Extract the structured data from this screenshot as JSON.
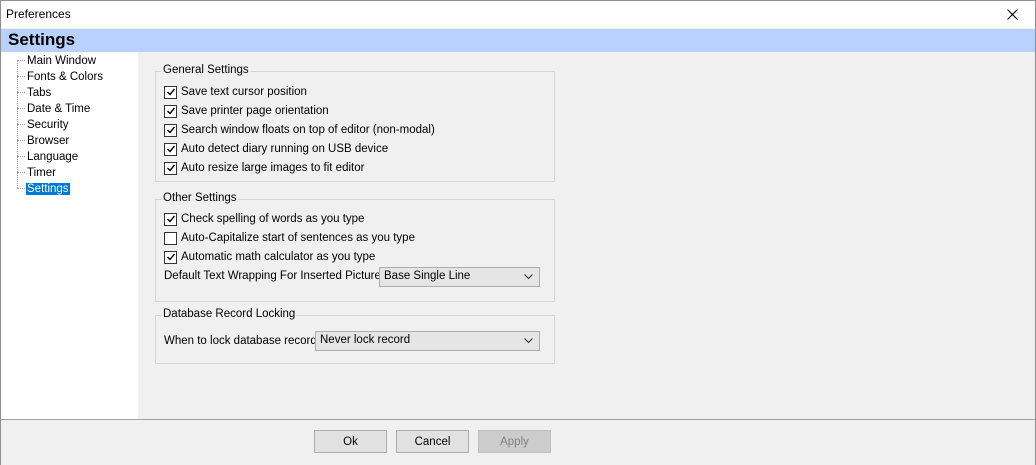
{
  "window": {
    "title": "Preferences"
  },
  "header": {
    "title": "Settings"
  },
  "tree": {
    "items": [
      {
        "label": "Main Window"
      },
      {
        "label": "Fonts & Colors"
      },
      {
        "label": "Tabs"
      },
      {
        "label": "Date & Time"
      },
      {
        "label": "Security"
      },
      {
        "label": "Browser"
      },
      {
        "label": "Language"
      },
      {
        "label": "Timer"
      },
      {
        "label": "Settings",
        "selected": true
      }
    ]
  },
  "general": {
    "label": "General Settings",
    "options": [
      {
        "label": "Save text cursor position",
        "checked": true
      },
      {
        "label": "Save printer page orientation",
        "checked": true
      },
      {
        "label": "Search window floats on top of editor (non-modal)",
        "checked": true
      },
      {
        "label": "Auto detect diary running on USB device",
        "checked": true
      },
      {
        "label": "Auto resize large images to fit editor",
        "checked": true
      }
    ]
  },
  "other": {
    "label": "Other Settings",
    "options": [
      {
        "label": "Check spelling of words as you type",
        "checked": true
      },
      {
        "label": "Auto-Capitalize start of sentences as you type",
        "checked": false
      },
      {
        "label": "Automatic math calculator as you type",
        "checked": true
      }
    ],
    "wrap_label": "Default Text Wrapping For Inserted Pictures",
    "wrap_value": "Base Single Line"
  },
  "locking": {
    "label": "Database Record Locking",
    "when_label": "When to lock database record",
    "when_value": "Never lock record"
  },
  "buttons": {
    "ok": "Ok",
    "cancel": "Cancel",
    "apply": "Apply"
  },
  "colors": {
    "header_bg": "#b9d1ff",
    "selection": "#0078d7"
  },
  "icons": {
    "close": "close-icon",
    "dropdown": "chevron-down-icon",
    "check": "checkmark-icon"
  }
}
